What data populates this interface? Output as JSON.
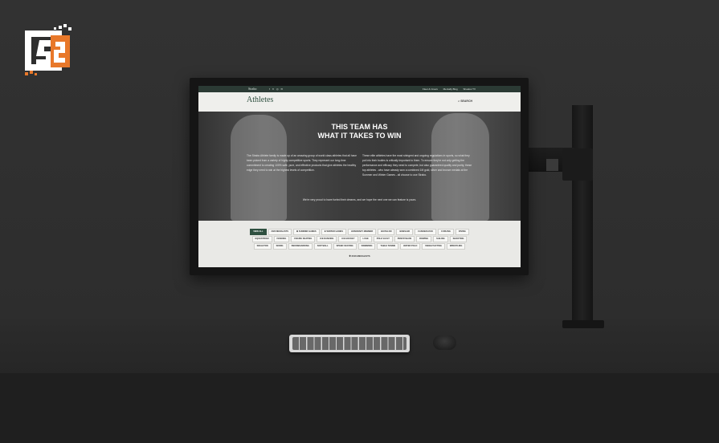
{
  "site": {
    "topbar": {
      "brand": "Strabo",
      "social": "f ✕ ◎ ✉",
      "links": [
        "Fleet & Crews",
        "Mentally Blog",
        "Shadow TV"
      ]
    },
    "header": {
      "title": "Athletes",
      "search_label": "SEARCH"
    },
    "hero": {
      "heading_line1": "THIS TEAM HAS",
      "heading_line2": "WHAT IT TAKES TO WIN",
      "left_text": "The Strabo Athlete family is made up of an amazing group of world class athletes that all have been picked from a variety of highly competitive sports. They represent our long-time commitment to creating 100% safe, pure, and effective products that give athletes the healthy edge they need to win at the highest levels of competition.",
      "right_text": "These elite athletes have the most stringent and ongoing regulations in sports, so what they put into their bodies is critically important to them. To ensure they're not only getting the performance and efficacy they need to compete, but also guaranteed quality and purity, these top athletes - who have already won a combined 1M gold, silver and bronze medals at the Summer and Winter Games - all choose to use Strabo.",
      "quote": "We're very proud to have fueled their dreams, and we hope the next one we can feature is yours."
    },
    "filters": {
      "row1": [
        "VIEW ALL",
        "2020 MEDALISTS",
        "✪ SUMMER GAMES",
        "❄ WINTER GAMES",
        "HONORARY MEMBER",
        "BIATHLON",
        "BOBSLED",
        "CANOE/KAYAK",
        "CURLING",
        "DIVING"
      ],
      "row2": [
        "EQUESTRIAN",
        "FENCING",
        "FIGURE SKATING",
        "ICE DANCING",
        "ICE HOCKEY",
        "LUGE",
        "POLE VAULT",
        "PENTATHLON",
        "ROWING",
        "SAILING",
        "SHOOTING"
      ],
      "row3": [
        "SKELETON",
        "SKIING",
        "SNOWBOARDING",
        "SOFTBALL",
        "SPEED SKATING",
        "SWIMMING",
        "TABLE TENNIS",
        "WATER POLO",
        "WEIGHTLIFTING",
        "WRESTLING"
      ],
      "more": "✚ 2016 MEDALISTS"
    }
  },
  "colors": {
    "accent": "#2f5040",
    "brand_orange": "#e8782a"
  }
}
